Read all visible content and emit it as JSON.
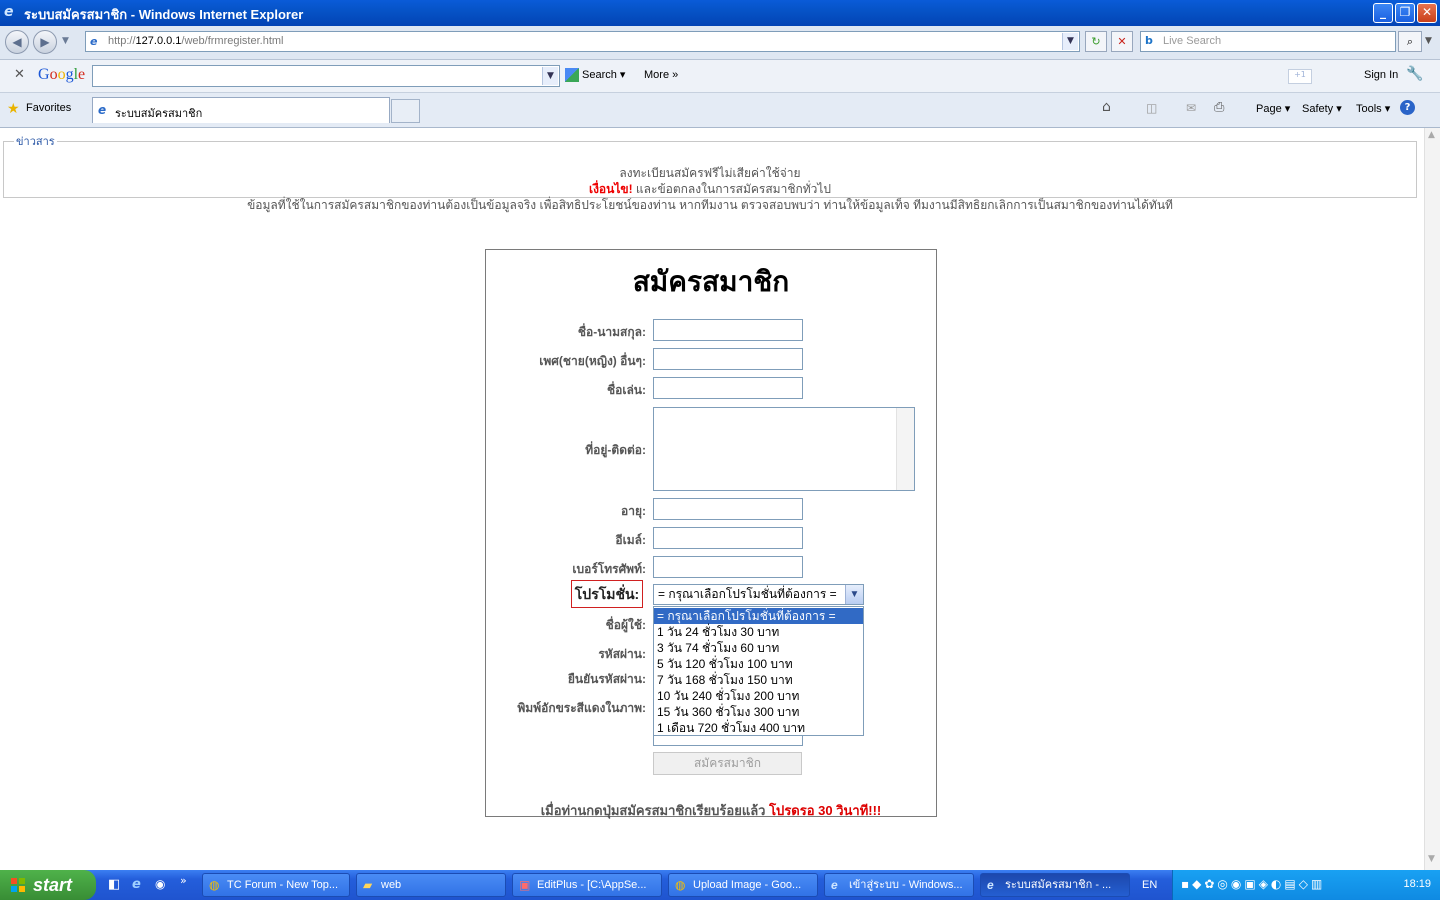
{
  "window": {
    "title": "ระบบสมัครสมาชิก - Windows Internet Explorer"
  },
  "address_bar": {
    "url_prefix": "http://",
    "url_host": "127.0.0.1",
    "url_path": "/web/frmregister.html",
    "search_placeholder": "Live Search"
  },
  "google_toolbar": {
    "logo": "Google",
    "search_label": "Search",
    "more_label": "More",
    "sign_in": "Sign In"
  },
  "favorites_bar": {
    "favorites_label": "Favorites",
    "tab_title": "ระบบสมัครสมาชิก",
    "commands": [
      "Page",
      "Safety",
      "Tools"
    ]
  },
  "news": {
    "legend": "ข่าวสาร",
    "line1": "ลงทะเบียนสมัครฟรีไม่เสียค่าใช้จ่าย",
    "line2_red": "เงื่อนไข!",
    "line2_rest": " และข้อตกลงในการสมัครสมาชิกทั่วไป",
    "line3": "ข้อมูลที่ใช้ในการสมัครสมาชิกของท่านต้องเป็นข้อมูลจริง เพื่อสิทธิประโยชน์ของท่าน หากทีมงาน ตรวจสอบพบว่า ท่านให้ข้อมูลเท็จ ทีมงานมีสิทธิยกเลิกการเป็นสมาชิกของท่านได้ทันที"
  },
  "form": {
    "title": "สมัครสมาชิก",
    "labels": {
      "fullname": "ชื่อ-นามสกุล:",
      "gender": "เพศ(ชาย(หญิง) อื่นๆ:",
      "nickname": "ชื่อเล่น:",
      "address": "ที่อยู่-ติดต่อ:",
      "age": "อายุ:",
      "email": "อีเมล์:",
      "phone": "เบอร์โทรศัพท์:",
      "promotion": "โปรโมชั่น:",
      "username": "ชื่อผู้ใช้:",
      "password": "รหัสผ่าน:",
      "confirm_password": "ยืนยันรหัสผ่าน:",
      "captcha": "พิมพ์อักขระสีแดงในภาพ:"
    },
    "promotion_selected": "= กรุณาเลือกโปรโมชั่นที่ต้องการ =",
    "promotion_options": [
      "= กรุณาเลือกโปรโมชั่นที่ต้องการ =",
      "1 วัน 24 ชั่วโมง 30 บาท",
      "3 วัน 74 ชั่วโมง 60 บาท",
      "5 วัน 120 ชั่วโมง 100 บาท",
      "7 วัน 168 ชั่วโมง 150 บาท",
      "10 วัน 240 ชั่วโมง 200 บาท",
      "15 วัน 360 ชั่วโมง 300 บาท",
      "1 เดือน 720 ชั่วโมง 400 บาท"
    ],
    "submit_label": "สมัครสมาชิก",
    "notice_text": "เมื่อท่านกดปุ่มสมัครสมาชิกเรียบร้อยแล้ว ",
    "notice_red": "โปรดรอ 30 วินาที!!!"
  },
  "taskbar": {
    "start_label": "start",
    "buttons": [
      "TC Forum - New Top...",
      "web",
      "EditPlus - [C:\\AppSe...",
      "Upload Image - Goo...",
      "เข้าสู่ระบบ - Windows...",
      "ระบบสมัครสมาชิก - ..."
    ],
    "language": "EN",
    "clock": "18:19"
  },
  "colors": {
    "titlebar": "#0653c7",
    "taskbar": "#245edb",
    "start": "#388d35",
    "selected_option": "#316ac5",
    "notice_red": "#d00000"
  }
}
